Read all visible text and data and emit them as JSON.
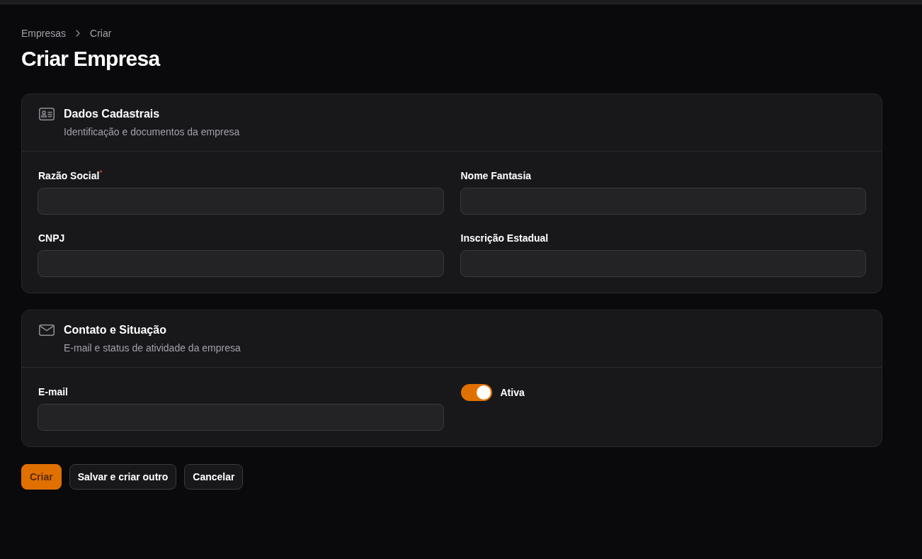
{
  "breadcrumbs": [
    {
      "label": "Empresas"
    },
    {
      "label": "Criar"
    }
  ],
  "page_title": "Criar Empresa",
  "sections": [
    {
      "title": "Dados Cadastrais",
      "subtitle": "Identificação e documentos da empresa",
      "fields": [
        {
          "kind": "text",
          "label": "Razão Social$^{*}$"
        },
        {
          "kind": "text",
          "label": "Nome Fantasia"
        },
        {
          "kind": "text",
          "label": "CNPJ"
        },
        {
          "kind": "text",
          "label": "Inscrição Estadual"
        }
      ]
    },
    {
      "title": "Contato e Situação",
      "subtitle": "E-mail e status de atividade da empresa",
      "fields": [
        {
          "kind": "text",
          "label": "E-mail"
        },
        {
          "kind": "toggle",
          "label": "Ativa",
          "on": true
        }
      ]
    }
  ],
  "actions": [
    {
      "kind": "primary",
      "label": "Criar"
    },
    {
      "kind": "secondary",
      "label": "Salvar e criar outro"
    },
    {
      "kind": "secondary",
      "label": "Cancelar"
    }
  ]
}
